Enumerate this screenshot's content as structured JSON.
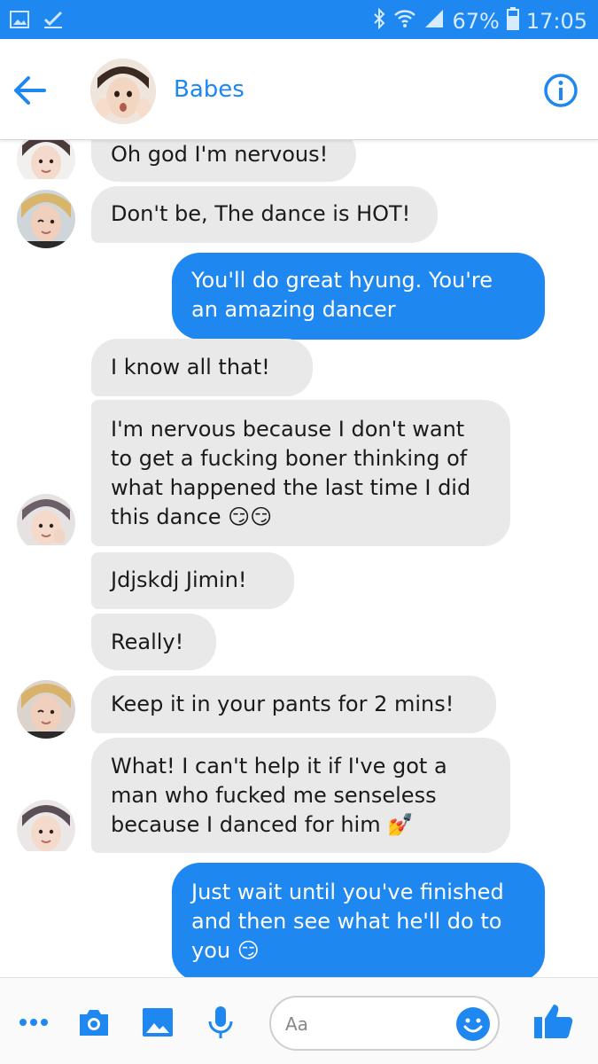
{
  "status_bar": {
    "battery": "67%",
    "time": "17:05"
  },
  "header": {
    "title": "Babes"
  },
  "messages": [
    {
      "side": "in",
      "text": "Oh god I'm nervous!"
    },
    {
      "side": "in",
      "text": "Don't be, The dance is HOT!"
    },
    {
      "side": "out",
      "text": "You'll do great hyung. You're an amazing dancer"
    },
    {
      "side": "in",
      "text": "I know all that!"
    },
    {
      "side": "in",
      "text": "I'm nervous because I don't want to get a fucking boner thinking of what happened the last time I did this dance 😏😏"
    },
    {
      "side": "in",
      "text": "Jdjskdj Jimin!"
    },
    {
      "side": "in",
      "text": "Really!"
    },
    {
      "side": "in",
      "text": "Keep it in your pants for 2 mins!"
    },
    {
      "side": "in",
      "text": "What! I can't help it if I've got a man who fucked me senseless because I danced for him 💅"
    },
    {
      "side": "out",
      "text": "Just wait until you've finished and then see what he'll do to you 😏"
    }
  ],
  "composer": {
    "placeholder": "Aa"
  },
  "colors": {
    "accent": "#1e87f0",
    "incoming_bubble": "#e9e9e9",
    "outgoing_bubble": "#1e87f0"
  }
}
